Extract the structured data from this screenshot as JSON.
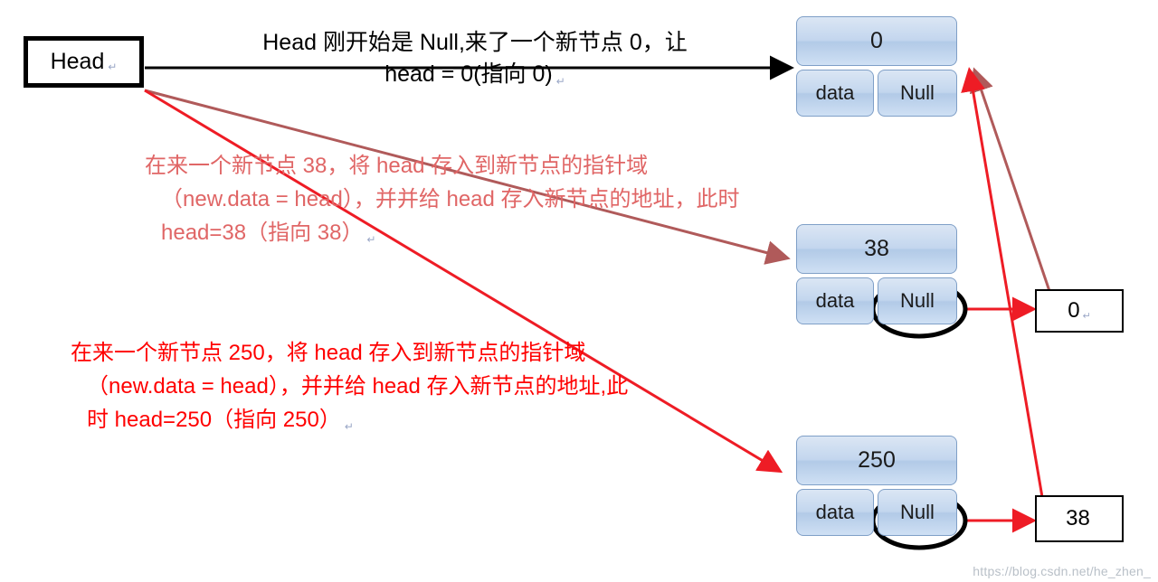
{
  "head": {
    "label": "Head",
    "pilcrow": "↵"
  },
  "captions": {
    "top_line1": "Head 刚开始是 Null,来了一个新节点 0，让",
    "top_line2": "head = 0(指向 0)",
    "top_pilcrow": "↵",
    "note1_line1": "在来一个新节点 38，将 head 存入到新节点的指针域",
    "note1_line2": "（new.data = head），并并给 head 存入新节点的地址，此时",
    "note1_line3": "head=38（指向 38）",
    "note1_pilcrow": "↵",
    "note2_line1": "在来一个新节点 250，将 head 存入到新节点的指针域",
    "note2_line2": "（new.data = head），并并给 head 存入新节点的地址,此",
    "note2_line3": "时 head=250（指向 250）",
    "note2_pilcrow": "↵"
  },
  "nodes": [
    {
      "id": "node-0",
      "value": "0",
      "data_label": "data",
      "next_label": "Null",
      "next_circled": false
    },
    {
      "id": "node-38",
      "value": "38",
      "data_label": "data",
      "next_label": "Null",
      "next_circled": true
    },
    {
      "id": "node-250",
      "value": "250",
      "data_label": "data",
      "next_label": "Null",
      "next_circled": true
    }
  ],
  "address_boxes": [
    {
      "id": "addr-0",
      "value": "0",
      "pilcrow": "↵"
    },
    {
      "id": "addr-38",
      "value": "38",
      "pilcrow": ""
    }
  ],
  "watermark": "https://blog.csdn.net/he_zhen_",
  "colors": {
    "arrow_red": "#ee1c25",
    "arrow_faded": "#b05a5a",
    "node_fill": "#c3d6ee",
    "node_border": "#7f9fc7",
    "text_red": "#ff0000",
    "black": "#000000"
  }
}
